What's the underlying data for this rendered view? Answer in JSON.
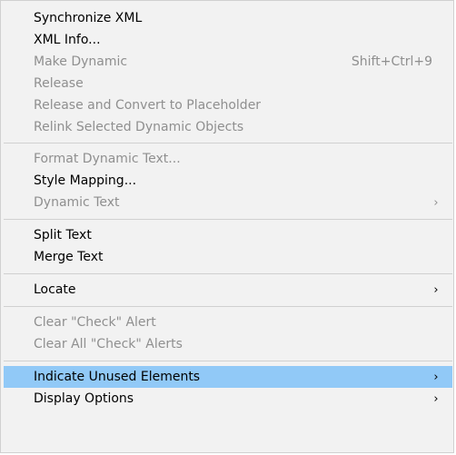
{
  "menu": {
    "items": [
      {
        "label": "Synchronize XML",
        "shortcut": "",
        "submenu": false,
        "disabled": false,
        "highlighted": false
      },
      {
        "label": "XML Info...",
        "shortcut": "",
        "submenu": false,
        "disabled": false,
        "highlighted": false
      },
      {
        "label": "Make Dynamic",
        "shortcut": "Shift+Ctrl+9",
        "submenu": false,
        "disabled": true,
        "highlighted": false
      },
      {
        "label": "Release",
        "shortcut": "",
        "submenu": false,
        "disabled": true,
        "highlighted": false
      },
      {
        "label": "Release and Convert to Placeholder",
        "shortcut": "",
        "submenu": false,
        "disabled": true,
        "highlighted": false
      },
      {
        "label": "Relink Selected Dynamic Objects",
        "shortcut": "",
        "submenu": false,
        "disabled": true,
        "highlighted": false
      },
      {
        "label": "Format Dynamic Text...",
        "shortcut": "",
        "submenu": false,
        "disabled": true,
        "highlighted": false
      },
      {
        "label": "Style Mapping...",
        "shortcut": "",
        "submenu": false,
        "disabled": false,
        "highlighted": false
      },
      {
        "label": "Dynamic Text",
        "shortcut": "",
        "submenu": true,
        "disabled": true,
        "highlighted": false
      },
      {
        "label": "Split Text",
        "shortcut": "",
        "submenu": false,
        "disabled": false,
        "highlighted": false
      },
      {
        "label": "Merge Text",
        "shortcut": "",
        "submenu": false,
        "disabled": false,
        "highlighted": false
      },
      {
        "label": "Locate",
        "shortcut": "",
        "submenu": true,
        "disabled": false,
        "highlighted": false
      },
      {
        "label": "Clear \"Check\" Alert",
        "shortcut": "",
        "submenu": false,
        "disabled": true,
        "highlighted": false
      },
      {
        "label": "Clear All \"Check\" Alerts",
        "shortcut": "",
        "submenu": false,
        "disabled": true,
        "highlighted": false
      },
      {
        "label": "Indicate Unused Elements",
        "shortcut": "",
        "submenu": true,
        "disabled": false,
        "highlighted": true
      },
      {
        "label": "Display Options",
        "shortcut": "",
        "submenu": true,
        "disabled": false,
        "highlighted": false
      }
    ],
    "submenu_arrow": "›",
    "colors": {
      "highlight": "#91c9f7",
      "disabled_text": "#8f8f8f",
      "background": "#f2f2f2"
    }
  }
}
